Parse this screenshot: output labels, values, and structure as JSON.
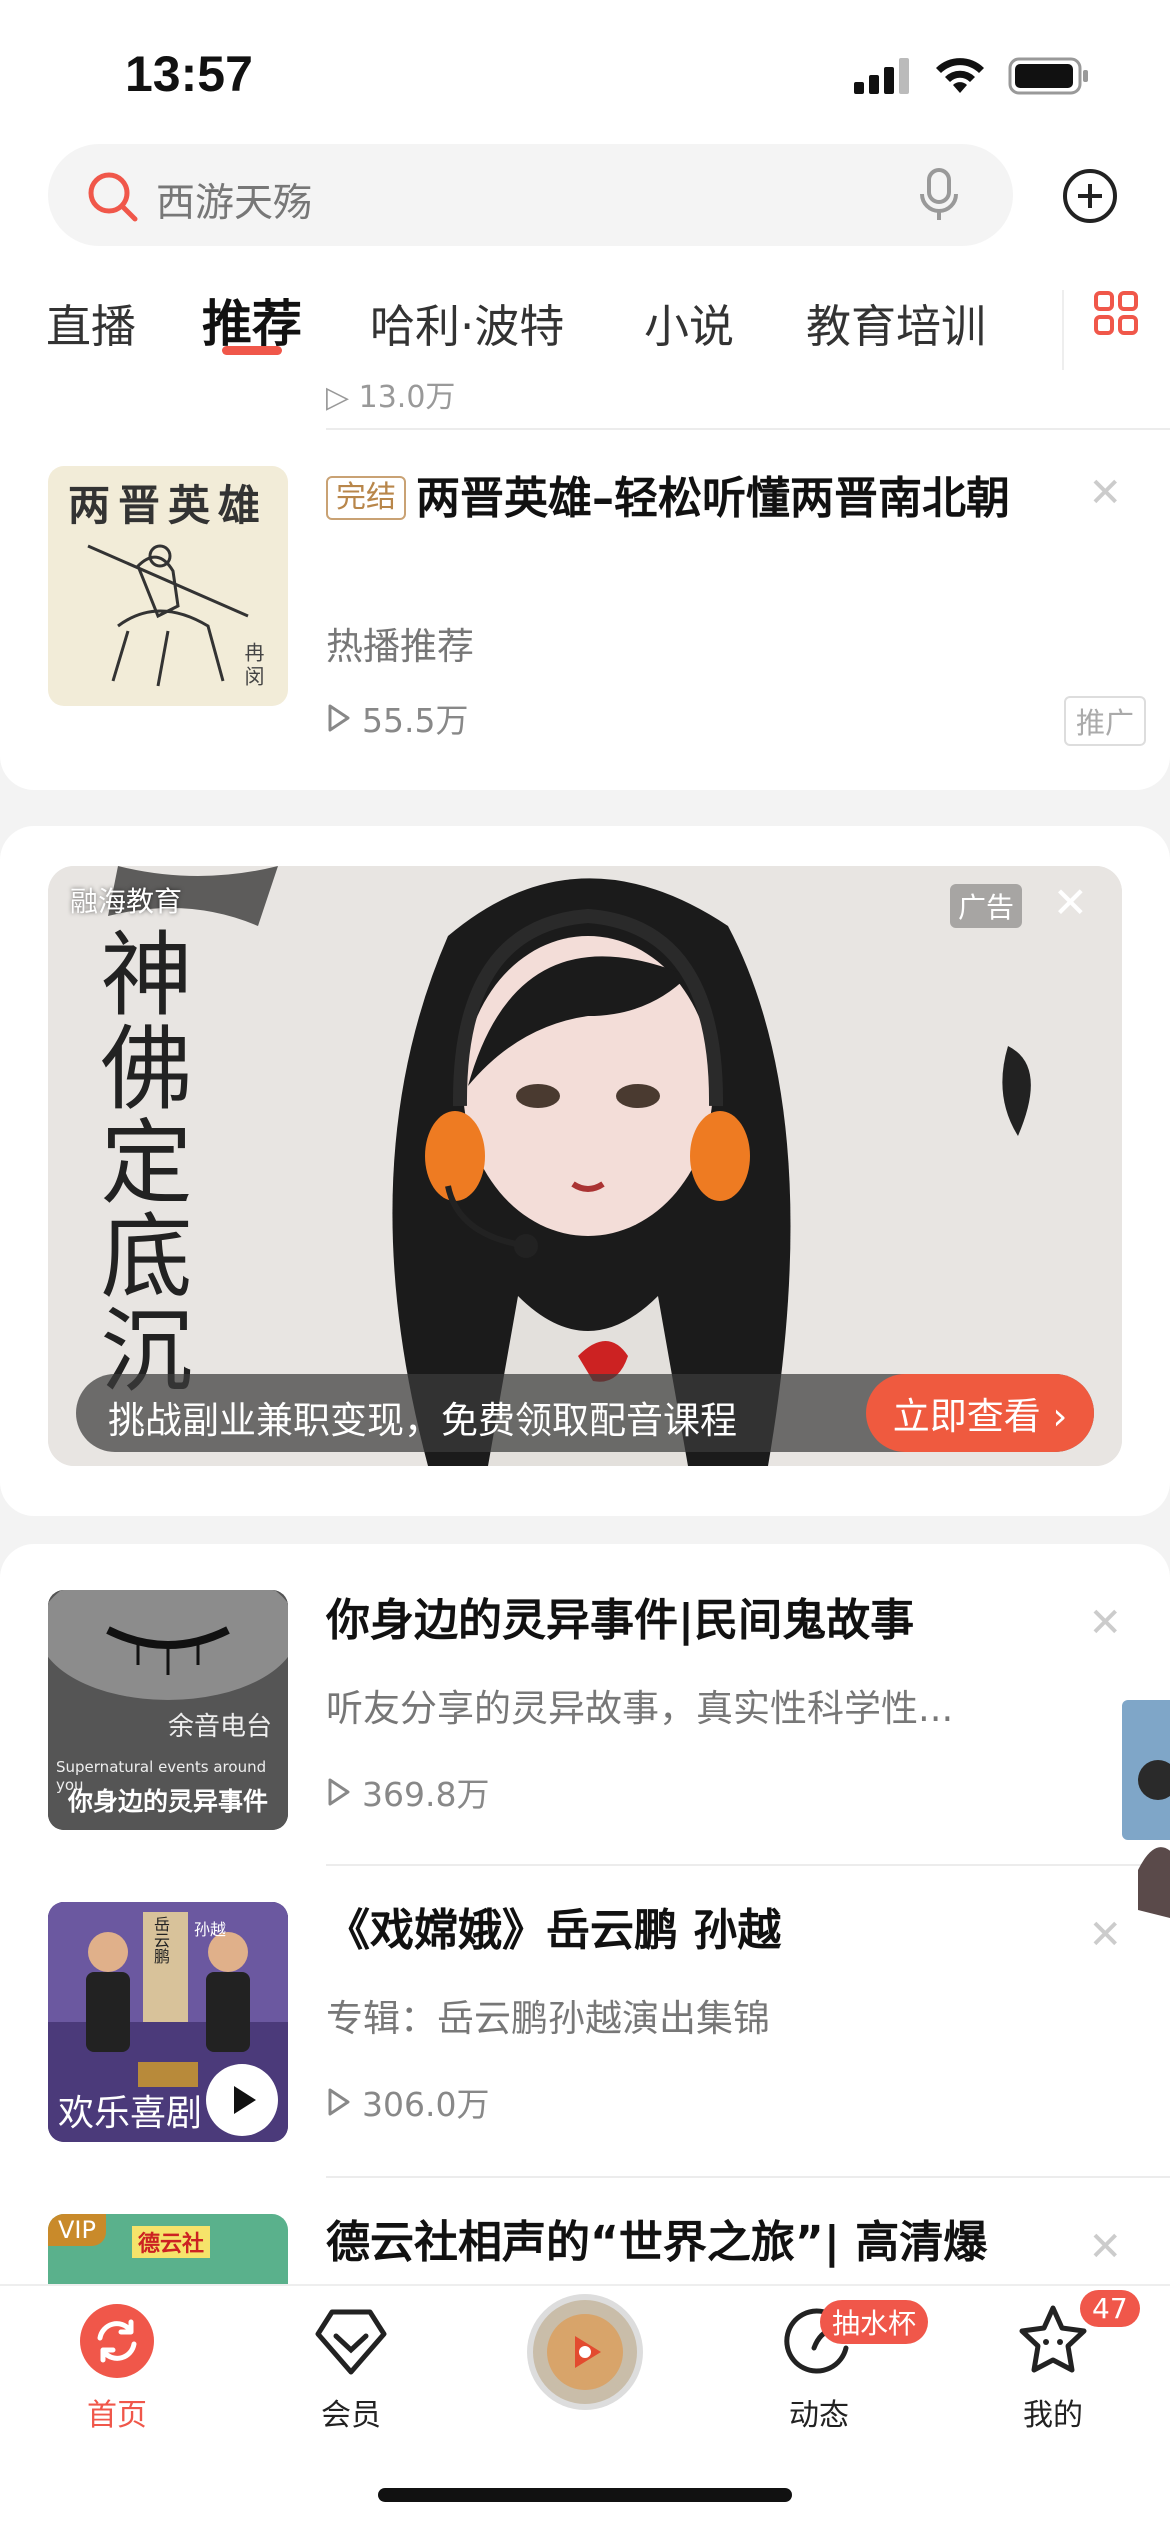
{
  "status_bar": {
    "time": "13:57"
  },
  "search": {
    "placeholder": "西游天殇"
  },
  "tabs": [
    "直播",
    "推荐",
    "哈利·波特",
    "小说",
    "教育培训"
  ],
  "active_tab": "推荐",
  "previous_item_plays": "13.0万",
  "feed_top": {
    "thumb_title": "两晋英雄",
    "thumb_caption": "冉闵",
    "tag": "完结",
    "title": "两晋英雄–轻松听懂两晋南北朝",
    "subtitle": "热播推荐",
    "plays": "55.5万",
    "promo_label": "推广"
  },
  "ad": {
    "brand": "融海教育",
    "label": "广告",
    "calligraphy": "神佛定底沉",
    "caption": "挑战副业兼职变现，免费领取配音课程",
    "cta": "立即查看 ›"
  },
  "feed": [
    {
      "thumb_text_top": "余音电台",
      "thumb_text_en": "Supernatural events around you",
      "thumb_text_cn": "你身边的灵异事件",
      "title": "你身边的灵异事件|民间鬼故事",
      "subtitle": "听友分享的灵异故事，真实性科学性...",
      "plays": "369.8万"
    },
    {
      "thumb_text_a": "岳云鹏",
      "thumb_text_b": "孙越",
      "thumb_text_cn": "欢乐喜剧",
      "title": "《戏嫦娥》岳云鹏 孙越",
      "subtitle": "专辑：岳云鹏孙越演出集锦",
      "plays": "306.0万"
    },
    {
      "vip": "VIP",
      "thumb_text_top": "德云社",
      "title": "德云社相声的“世界之旅”| 高清爆",
      "subtitle": "",
      "plays": ""
    }
  ],
  "bottom_nav": {
    "home": "首页",
    "vip": "会员",
    "dynamic": "动态",
    "dynamic_badge": "抽水杯",
    "mine": "我的",
    "mine_badge": "47"
  },
  "colors": {
    "accent": "#f0574a",
    "cta": "#ef5a3f"
  }
}
